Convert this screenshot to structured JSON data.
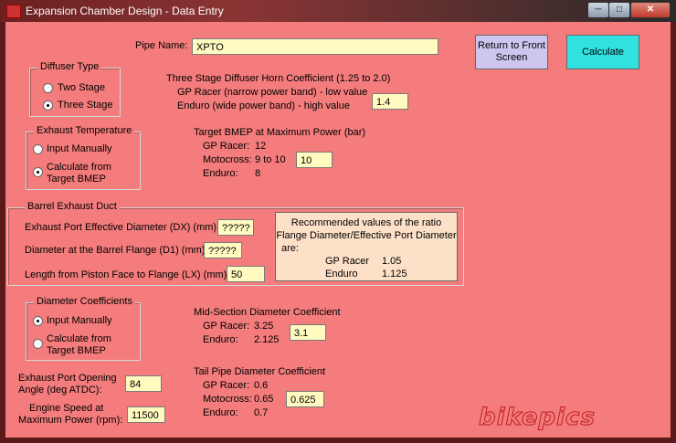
{
  "window": {
    "title": "Expansion Chamber Design - Data Entry",
    "min": "─",
    "max": "□",
    "close": "✕"
  },
  "pipe_name": {
    "label": "Pipe Name:",
    "value": "XPTO"
  },
  "buttons": {
    "return": "Return to Front Screen",
    "calculate": "Calculate"
  },
  "diffuser": {
    "title": "Diffuser Type",
    "options": [
      "Two Stage",
      "Three Stage"
    ],
    "selected": 1
  },
  "horn": {
    "line1": "Three Stage Diffuser Horn Coefficient  (1.25 to 2.0)",
    "line2": "GP Racer (narrow power band) - low value",
    "line3": "Enduro (wide power band) - high value",
    "value": "1.4"
  },
  "exhaust_temp": {
    "title": "Exhaust Temperature",
    "opt1": "Input Manually",
    "opt2a": "Calculate from",
    "opt2b": "Target BMEP",
    "selected": 1
  },
  "bmep": {
    "title": "Target BMEP at Maximum Power (bar)",
    "gp_label": "GP Racer:",
    "gp_value": "12",
    "moto_label": "Motocross:",
    "moto_value": "9 to 10",
    "enduro_label": "Enduro:",
    "enduro_value": "8",
    "input": "10"
  },
  "barrel": {
    "title": "Barrel Exhaust Duct",
    "dx_label": "Exhaust Port Effective Diameter (DX) (mm):",
    "dx_value": "?????",
    "d1_label": "Diameter at the Barrel Flange (D1) (mm):",
    "d1_value": "?????",
    "lx_label": "Length from Piston Face to Flange (LX) (mm):",
    "lx_value": "50"
  },
  "recommended": {
    "line1": "Recommended values of the ratio",
    "line2": "Flange Diameter/Effective Port Diameter",
    "line3": "are:",
    "gp_label": "GP Racer",
    "gp_value": "1.05",
    "enduro_label": "Enduro",
    "enduro_value": "1.125"
  },
  "diam_coef": {
    "title": "Diameter Coefficients",
    "opt1": "Input Manually",
    "opt2a": "Calculate from",
    "opt2b": "Target BMEP",
    "selected": 0
  },
  "midsection": {
    "title": "Mid-Section Diameter Coefficient",
    "gp_label": "GP Racer:",
    "gp_value": "3.25",
    "enduro_label": "Enduro:",
    "enduro_value": "2.125",
    "input": "3.1"
  },
  "tailpipe": {
    "title": "Tail Pipe Diameter Coefficient",
    "gp_label": "GP Racer:",
    "gp_value": "0.6",
    "moto_label": "Motocross:",
    "moto_value": "0.65",
    "enduro_label": "Enduro:",
    "enduro_value": "0.7",
    "input": "0.625"
  },
  "port_angle": {
    "label1": "Exhaust Port Opening",
    "label2": "Angle (deg ATDC):",
    "value": "84"
  },
  "engine_speed": {
    "label1": "Engine Speed at",
    "label2": "Maximum Power (rpm):",
    "value": "11500"
  },
  "watermark": "bikepics",
  "colors": {
    "background": "#f47c7c",
    "field": "#fffbc0",
    "return_button": "#cfc6f0",
    "calculate_button": "#33e0e0",
    "recommend_box": "#fde0c8"
  }
}
